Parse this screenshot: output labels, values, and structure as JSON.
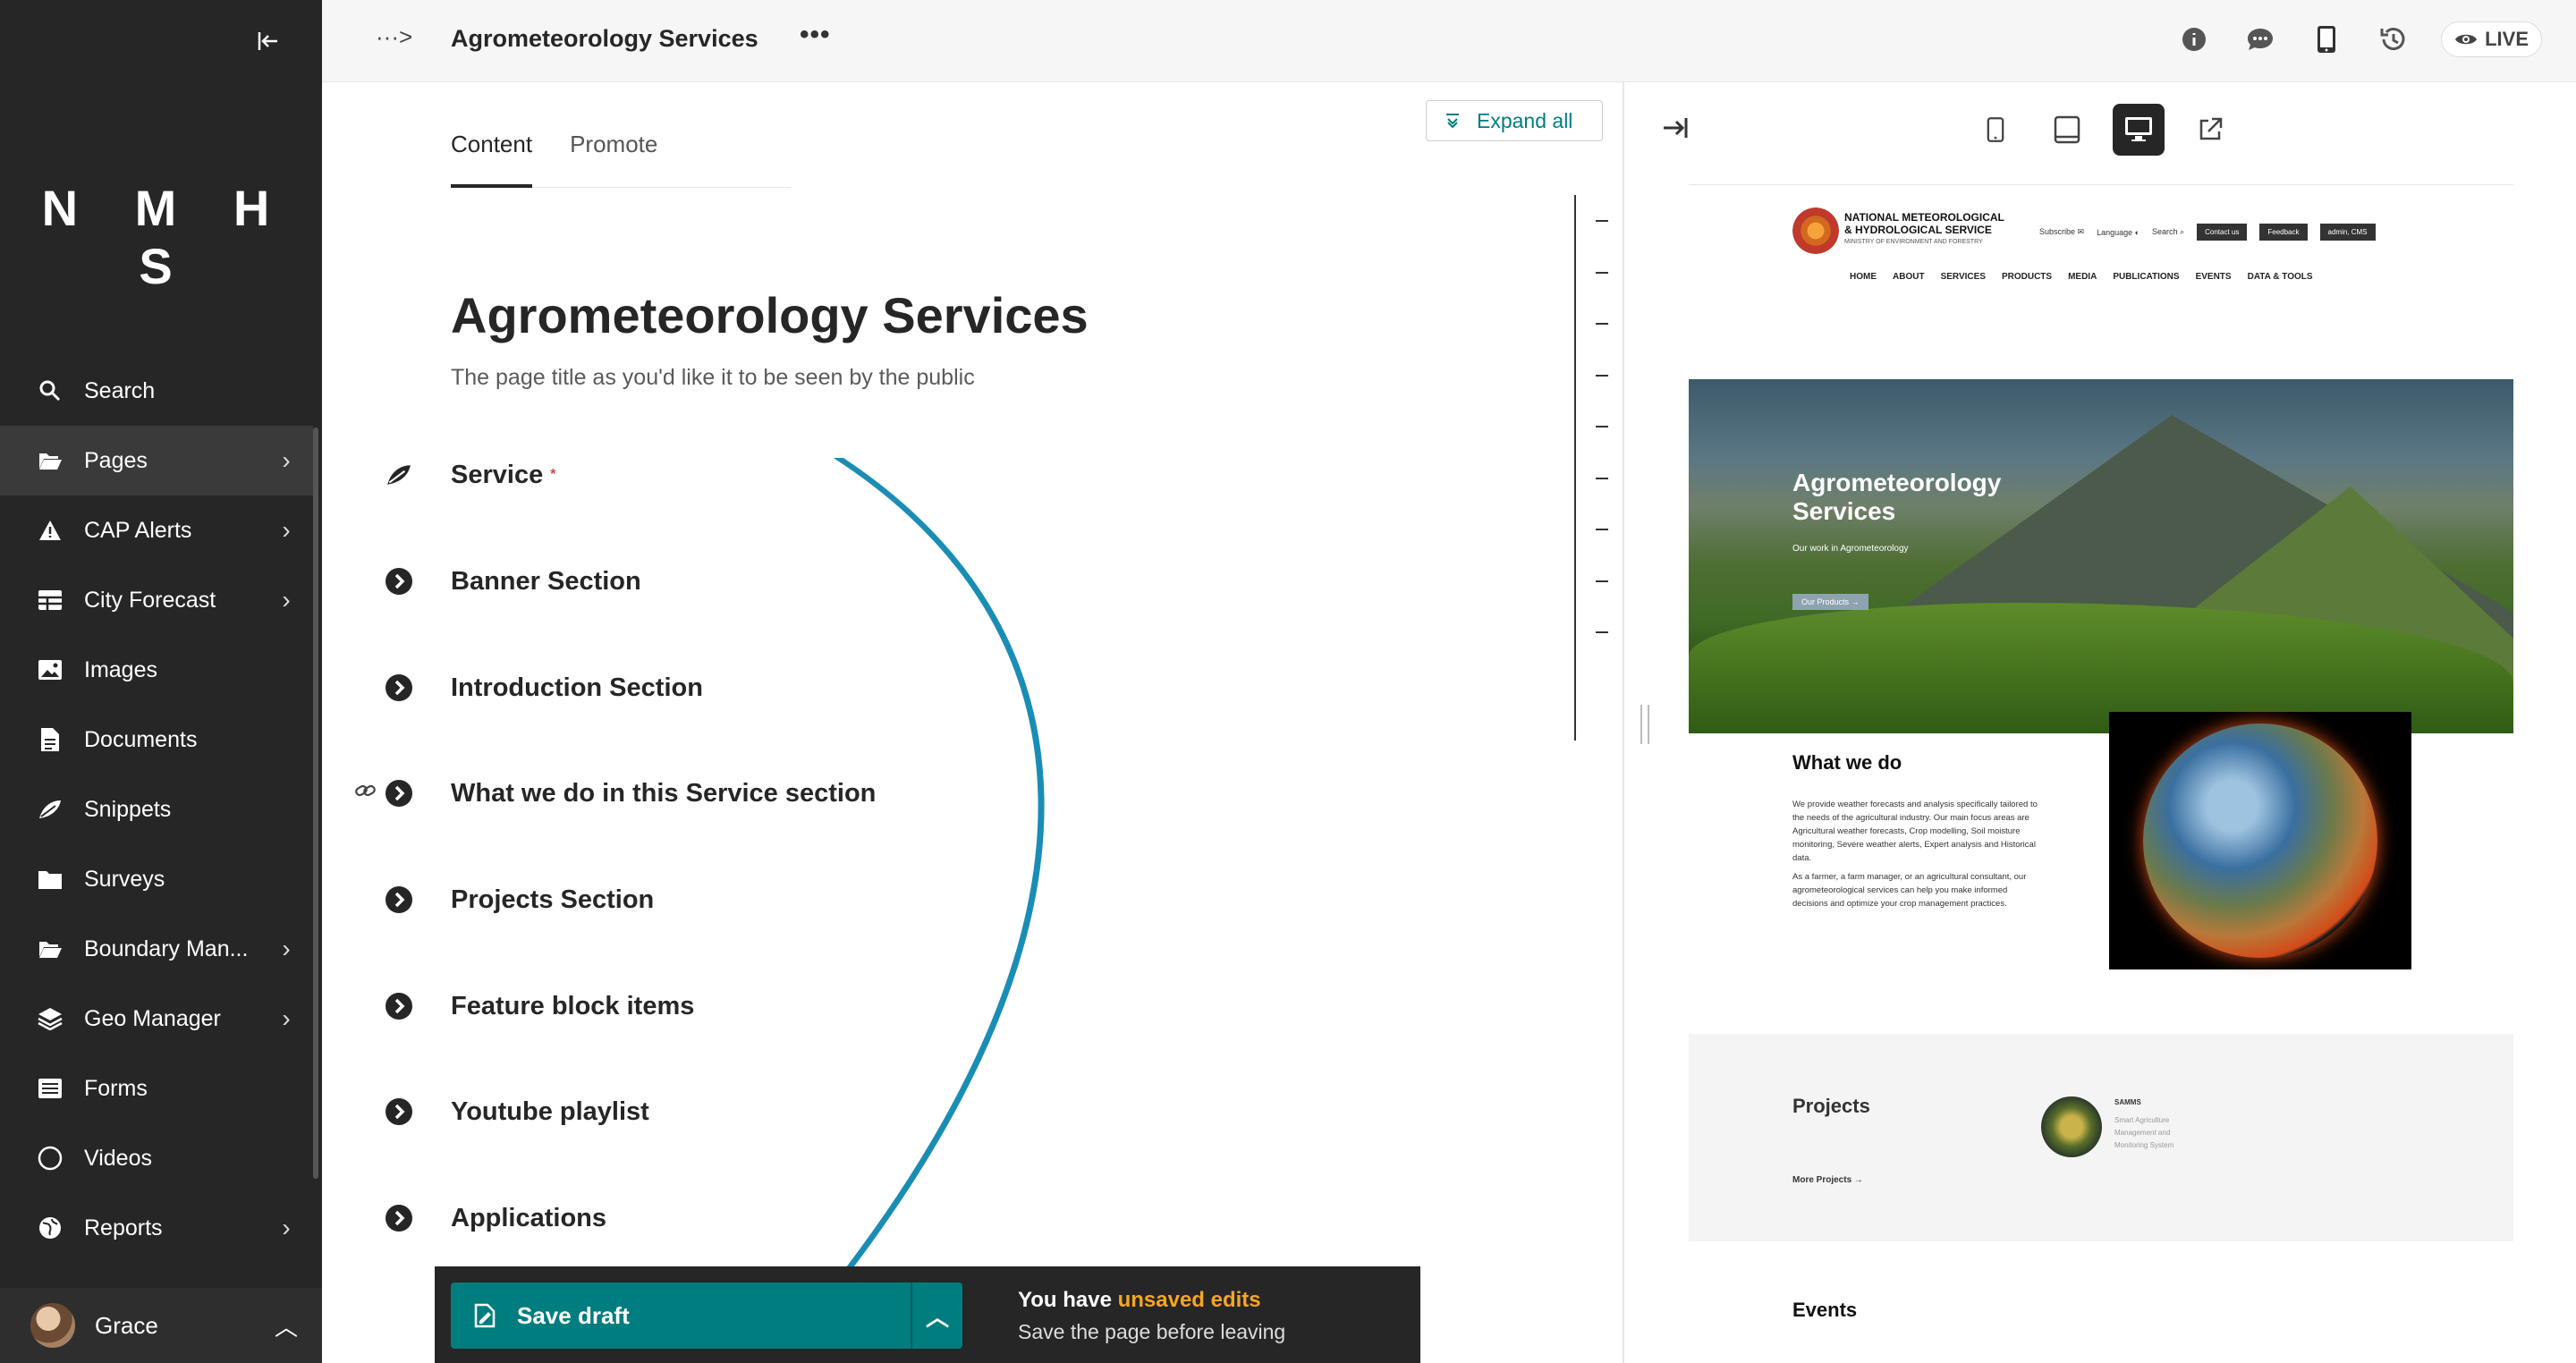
{
  "sidebar": {
    "logo": "N M H S",
    "collapse_icon": "collapse-left-icon",
    "items": [
      {
        "label": "Search",
        "icon": "search-icon",
        "has_children": false
      },
      {
        "label": "Pages",
        "icon": "folder-open-icon",
        "has_children": true,
        "active": true
      },
      {
        "label": "CAP Alerts",
        "icon": "warning-icon",
        "has_children": true
      },
      {
        "label": "City Forecast",
        "icon": "table-icon",
        "has_children": true
      },
      {
        "label": "Images",
        "icon": "image-icon",
        "has_children": false
      },
      {
        "label": "Documents",
        "icon": "document-icon",
        "has_children": false
      },
      {
        "label": "Snippets",
        "icon": "snippet-icon",
        "has_children": false
      },
      {
        "label": "Surveys",
        "icon": "folder-icon",
        "has_children": false
      },
      {
        "label": "Boundary Man...",
        "icon": "folder-open-icon",
        "has_children": true
      },
      {
        "label": "Geo Manager",
        "icon": "layers-icon",
        "has_children": true
      },
      {
        "label": "Forms",
        "icon": "list-icon",
        "has_children": false
      },
      {
        "label": "Videos",
        "icon": "circle-icon",
        "has_children": false
      },
      {
        "label": "Reports",
        "icon": "globe-icon",
        "has_children": true
      }
    ],
    "user": {
      "name": "Grace"
    }
  },
  "header": {
    "breadcrumb_toggle": "···>",
    "title": "Agrometeorology Services",
    "more": "•••",
    "live_label": "LIVE"
  },
  "editor": {
    "tabs": [
      "Content",
      "Promote"
    ],
    "expand_all": "Expand all",
    "title_value": "Agrometeorology Services",
    "title_help": "The page title as you'd like it to be seen by the public",
    "sections": [
      {
        "label": "Service",
        "required": "*",
        "icon": "snippet-icon"
      },
      {
        "label": "Banner Section",
        "icon": "chevron-circle-icon"
      },
      {
        "label": "Introduction Section",
        "icon": "chevron-circle-icon"
      },
      {
        "label": "What we do in this Service section",
        "icon": "chevron-circle-icon",
        "linked": true
      },
      {
        "label": "Projects Section",
        "icon": "chevron-circle-icon"
      },
      {
        "label": "Feature block items",
        "icon": "chevron-circle-icon"
      },
      {
        "label": "Youtube playlist",
        "icon": "chevron-circle-icon"
      },
      {
        "label": "Applications",
        "icon": "chevron-circle-icon"
      }
    ]
  },
  "savebar": {
    "save_label": "Save draft",
    "notice_prefix": "You have ",
    "notice_highlight": "unsaved edits",
    "notice_sub": "Save the page before leaving"
  },
  "preview": {
    "site": {
      "org_line1": "NATIONAL METEOROLOGICAL",
      "org_line2": "& HYDROLOGICAL SERVICE",
      "org_line3": "MINISTRY OF ENVIRONMENT AND FORESTRY",
      "util": [
        "Subscribe ✉",
        "Language ◐",
        "Search ⌕"
      ],
      "util_buttons": [
        "Contact us",
        "Feedback",
        "admin, CMS"
      ],
      "nav": [
        "HOME",
        "ABOUT",
        "SERVICES",
        "PRODUCTS",
        "MEDIA",
        "PUBLICATIONS",
        "EVENTS",
        "DATA & TOOLS"
      ],
      "hero_title_1": "Agrometeorology",
      "hero_title_2": "Services",
      "hero_sub": "Our work in Agrometeorology",
      "hero_btn": "Our Products →",
      "what_title": "What we do",
      "what_p1": "We provide weather forecasts and analysis specifically tailored to the needs of the agricultural industry. Our main focus areas are Agricultural weather forecasts, Crop modelling, Soil moisture monitoring, Severe weather alerts, Expert analysis and Historical data.",
      "what_p2": "As a farmer, a farm manager, or an agricultural consultant, our agrometeorological services can help you make informed decisions and optimize your crop management practices.",
      "projects_title": "Projects",
      "projects_more": "More Projects →",
      "project_name": "SAMMS",
      "project_desc": "Smart Agriculture Management and Monitoring System",
      "events_title": "Events"
    }
  }
}
